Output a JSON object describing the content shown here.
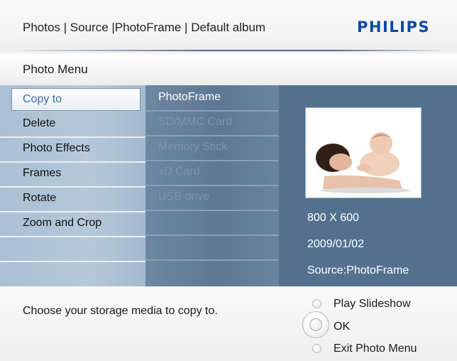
{
  "header": {
    "breadcrumb": "Photos | Source |PhotoFrame | Default album",
    "brand": "PHILIPS",
    "brand_color": "#0b4aa5"
  },
  "menu": {
    "title": "Photo Menu",
    "items": [
      {
        "label": "Copy to",
        "selected": true
      },
      {
        "label": "Delete"
      },
      {
        "label": "Photo Effects"
      },
      {
        "label": "Frames"
      },
      {
        "label": "Rotate"
      },
      {
        "label": "Zoom and Crop"
      }
    ]
  },
  "submenu": {
    "items": [
      {
        "label": "PhotoFrame",
        "enabled": true
      },
      {
        "label": "SD/MMC Card",
        "enabled": false
      },
      {
        "label": "Memory Stick",
        "enabled": false
      },
      {
        "label": "xD Card",
        "enabled": false
      },
      {
        "label": "USB drive",
        "enabled": false
      }
    ]
  },
  "preview": {
    "thumbnail": "mother-and-baby-photo",
    "resolution": "800 X 600",
    "date": "2009/01/02",
    "source": "Source:PhotoFrame"
  },
  "footer": {
    "help": "Choose your storage media to copy to.",
    "controls": [
      {
        "icon": "button-icon",
        "label": "Play Slideshow"
      },
      {
        "icon": "ok-dial-icon",
        "label": "OK"
      },
      {
        "icon": "button-icon",
        "label": "Exit Photo Menu"
      }
    ]
  }
}
